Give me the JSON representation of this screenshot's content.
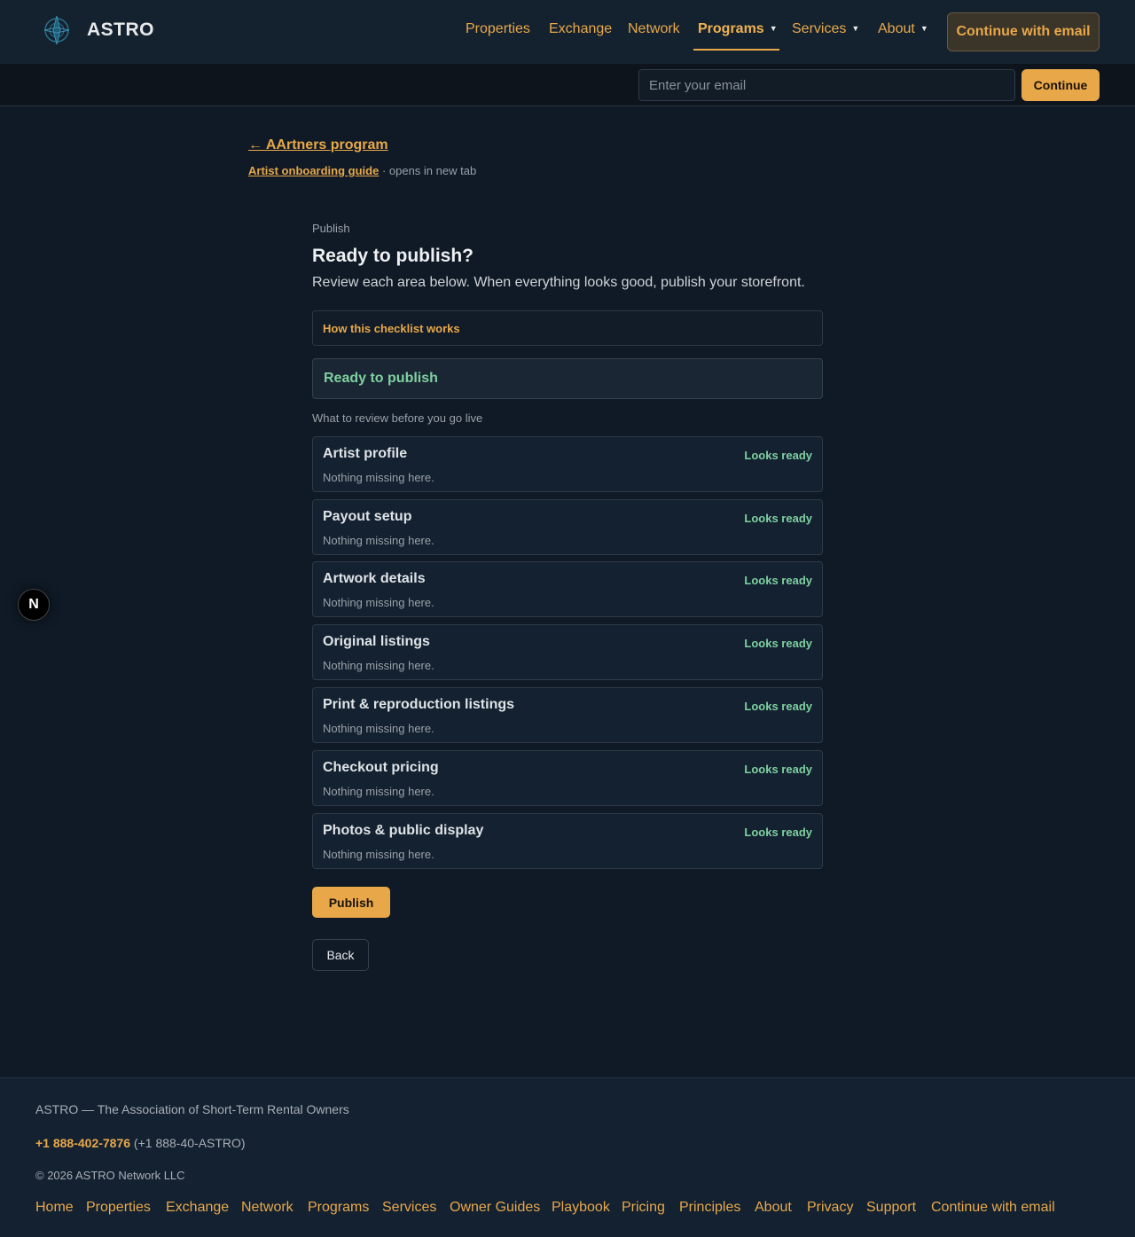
{
  "header": {
    "brand": "ASTRO",
    "nav": [
      {
        "label": "Properties"
      },
      {
        "label": "Exchange"
      },
      {
        "label": "Network"
      },
      {
        "label": "Programs"
      },
      {
        "label": "Services"
      },
      {
        "label": "About"
      }
    ],
    "active_nav": "Programs",
    "cta_label": "Continue with email"
  },
  "email_bar": {
    "placeholder": "Enter your email",
    "value": "",
    "button_label": "Continue"
  },
  "breadcrumb": {
    "back_label": "← AArtners program",
    "guide_label": "Artist onboarding guide",
    "guide_note": " · opens in new tab"
  },
  "main": {
    "eyebrow": "Publish",
    "title": "Ready to publish?",
    "subtitle": "Review each area below. When everything looks good, publish your storefront.",
    "how_label": "How this checklist works",
    "ready_label": "Ready to publish",
    "review_label": "What to review before you go live",
    "items": [
      {
        "title": "Artist profile",
        "desc": "Nothing missing here.",
        "status": "Looks ready"
      },
      {
        "title": "Payout setup",
        "desc": "Nothing missing here.",
        "status": "Looks ready"
      },
      {
        "title": "Artwork details",
        "desc": "Nothing missing here.",
        "status": "Looks ready"
      },
      {
        "title": "Original listings",
        "desc": "Nothing missing here.",
        "status": "Looks ready"
      },
      {
        "title": "Print & reproduction listings",
        "desc": "Nothing missing here.",
        "status": "Looks ready"
      },
      {
        "title": "Checkout pricing",
        "desc": "Nothing missing here.",
        "status": "Looks ready"
      },
      {
        "title": "Photos & public display",
        "desc": "Nothing missing here.",
        "status": "Looks ready"
      }
    ],
    "publish_label": "Publish",
    "back_label": "Back"
  },
  "badge": {
    "letter": "N"
  },
  "footer": {
    "tagline": "ASTRO — The Association of Short-Term Rental Owners",
    "phone": "+1 888-402-7876",
    "phone_alt": " (+1 888-40-ASTRO)",
    "copyright": "© 2026 ASTRO Network LLC",
    "links": [
      {
        "label": "Home"
      },
      {
        "label": "Properties"
      },
      {
        "label": "Exchange"
      },
      {
        "label": "Network"
      },
      {
        "label": "Programs"
      },
      {
        "label": "Services"
      },
      {
        "label": "Owner Guides"
      },
      {
        "label": "Playbook"
      },
      {
        "label": "Pricing"
      },
      {
        "label": "Principles"
      },
      {
        "label": "About"
      },
      {
        "label": "Privacy"
      },
      {
        "label": "Support"
      },
      {
        "label": "Continue with email"
      }
    ]
  },
  "colors": {
    "accent": "#e8a84a",
    "success": "#7fd0a0",
    "background": "#0f1a26",
    "header": "#142230"
  }
}
